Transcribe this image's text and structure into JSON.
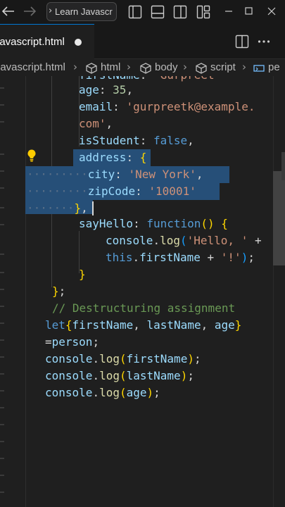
{
  "titlebar": {
    "search_text": "Learn Javascr",
    "search_chevron": "›",
    "back_icon": "arrow-left-icon",
    "forward_icon": "arrow-right-icon",
    "layout_icons": [
      "toggle-sidebar-icon",
      "toggle-panel-icon",
      "toggle-secondary-sidebar-icon",
      "customize-layout-icon"
    ],
    "window_controls": [
      "minimize",
      "maximize",
      "close"
    ]
  },
  "tab": {
    "label": "javascript.html",
    "modified": true
  },
  "tab_actions": [
    "split-editor-icon",
    "more-actions-icon"
  ],
  "breadcrumb": [
    "javascript.html",
    "html",
    "body",
    "script",
    "pe"
  ],
  "editor": {
    "lines": [
      "    firstName: ...",
      "age: 35,",
      "email: 'gurpreetk@example.",
      "com',",
      "isStudent: false,",
      "address: {",
      "city: 'New York',",
      "zipCode: '10001'",
      "},",
      "sayHello: function() {",
      "console.log('Hello, ' +",
      "this.firstName + '!');",
      "}",
      "};",
      "// Destructuring assignment",
      "let{firstName, lastName, age}",
      "=person;",
      "console.log(firstName);",
      "console.log(lastName);",
      "console.log(age);"
    ],
    "tokens": {
      "age_key": "age",
      "age_val": "35",
      "email_key": "email",
      "email_val1": "'gurpreetk@example.",
      "email_val2": "com'",
      "isStudent_key": "isStudent",
      "isStudent_val": "false",
      "address_key": "address",
      "city_key": "city",
      "city_val": "'New York'",
      "zip_key": "zipCode",
      "zip_val": "'10001'",
      "sayHello_key": "sayHello",
      "function_kw": "function",
      "console": "console",
      "log": "log",
      "hello_str": "'Hello, '",
      "this_kw": "this",
      "firstName": "firstName",
      "bang_str": "'!'",
      "comment": "// Destructuring assignment",
      "let_kw": "let",
      "lastName": "lastName",
      "age": "age",
      "person": "person"
    }
  },
  "colors": {
    "selection": "#264f78",
    "accent": "#0078d4",
    "keyword": "#569cd6",
    "property": "#9cdcfe",
    "string": "#ce9178",
    "number": "#b5cea8",
    "function": "#dcdcaa",
    "comment": "#6a9955"
  }
}
